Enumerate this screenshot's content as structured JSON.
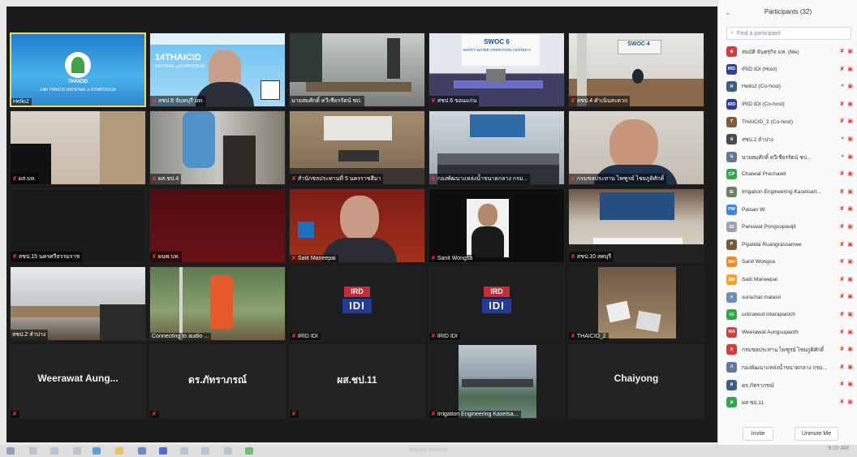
{
  "tiles": [
    {
      "name": "Hello2",
      "mic_off": false,
      "big_name": "",
      "scene": "logo",
      "active": true,
      "caption_line1": "THAICID",
      "caption_line2": "14th THAICID NATIONAL e-SYMPOSIUM"
    },
    {
      "name": "สชป.8 จันทบุรี มท.",
      "mic_off": true,
      "big_name": "",
      "scene": "speaker_banner",
      "active": false,
      "caption_line1": "14THAICID",
      "caption_line2": "NATIONAL e-SYMPOSIUM"
    },
    {
      "name": "นายสมศักดิ์ ควีเชียรรัตน์ ชป.",
      "mic_off": false,
      "big_name": "",
      "scene": "meeting_room",
      "active": false
    },
    {
      "name": "สชป.6 ขอนแก่น",
      "mic_off": true,
      "big_name": "",
      "scene": "swoc6",
      "active": false,
      "caption_line1": "SWOC 6",
      "caption_line2": "SMART WATER OPERATION CENTER 6"
    },
    {
      "name": "สชป.4 ดำเนินสะดวก",
      "mic_off": true,
      "big_name": "",
      "scene": "swoc4",
      "active": false,
      "caption_line1": "SWOC 4"
    },
    {
      "name": "ผส.บท.",
      "mic_off": true,
      "big_name": "",
      "scene": "office_chair",
      "active": false
    },
    {
      "name": "ผส.ชป.4",
      "mic_off": true,
      "big_name": "",
      "scene": "person_blue",
      "active": false
    },
    {
      "name": "สำนักชลประทานที่ 5 นครราชสีมา",
      "mic_off": true,
      "big_name": "",
      "scene": "meeting_board",
      "active": false
    },
    {
      "name": "กองพัฒนาแหล่งน้ำขนาดกลาง กรม...",
      "mic_off": true,
      "big_name": "",
      "scene": "conference_room",
      "active": false
    },
    {
      "name": "กรมชลประทาน ไพฑูรย์ ไชยภูติศักดิ์",
      "mic_off": true,
      "big_name": "",
      "scene": "older_man",
      "active": false
    },
    {
      "name": "สชป.15 นครศรีธรรมราช",
      "mic_off": true,
      "big_name": "",
      "scene": "black",
      "active": false
    },
    {
      "name": "ผนพ.บท.",
      "mic_off": true,
      "big_name": "",
      "scene": "dark_red",
      "active": false
    },
    {
      "name": "Satit Maneepai",
      "mic_off": true,
      "big_name": "",
      "scene": "man_red_bg",
      "active": false
    },
    {
      "name": "Sanit Wongsa",
      "mic_off": true,
      "big_name": "",
      "scene": "photo_man",
      "active": false
    },
    {
      "name": "สชป.10 ลพบุรี",
      "mic_off": true,
      "big_name": "",
      "scene": "meeting_room2",
      "active": false
    },
    {
      "name": "สชป.2 ลำปาง",
      "mic_off": false,
      "big_name": "",
      "scene": "hall",
      "active": false
    },
    {
      "name": "Connecting to audio ...",
      "mic_off": false,
      "big_name": "",
      "scene": "orange_device",
      "active": false
    },
    {
      "name": "IRID IDI",
      "mic_off": true,
      "big_name": "",
      "scene": "idi",
      "active": false
    },
    {
      "name": "IRID IDI",
      "mic_off": true,
      "big_name": "",
      "scene": "idi",
      "active": false
    },
    {
      "name": "THAICID_2",
      "mic_off": true,
      "big_name": "",
      "scene": "desk_papers",
      "active": false
    },
    {
      "name": "",
      "mic_off": true,
      "big_name": "Weerawat Aung...",
      "scene": "name_only",
      "active": false
    },
    {
      "name": "",
      "mic_off": true,
      "big_name": "ดร.ภัทราภรณ์",
      "scene": "name_only",
      "active": false
    },
    {
      "name": "",
      "mic_off": true,
      "big_name": "ผส.ชป.11",
      "scene": "name_only",
      "active": false
    },
    {
      "name": "Irrigation Engineering Kasetsa...",
      "mic_off": true,
      "big_name": "",
      "scene": "dam",
      "active": false
    },
    {
      "name": "",
      "mic_off": false,
      "big_name": "Chaiyong",
      "scene": "name_only",
      "active": false
    }
  ],
  "panel": {
    "title": "Participants (32)",
    "search_placeholder": "Find a participant",
    "invite_label": "Invite",
    "unmute_label": "Unmute Me",
    "participants": [
      {
        "name": "สมบัติ จันทรุกิจ มท. (Me)",
        "avatar": "ส",
        "color": "#d93a3a",
        "mic": "off"
      },
      {
        "name": "IRID IDI (Host)",
        "avatar": "IRD",
        "color": "#2b3f9a",
        "mic": "off"
      },
      {
        "name": "Hello2 (Co-host)",
        "avatar": "H",
        "color": "#3b5e89",
        "mic": "on"
      },
      {
        "name": "IRID IDI (Co-host)",
        "avatar": "IRD",
        "color": "#2b3f9a",
        "mic": "off"
      },
      {
        "name": "THAICID_2 (Co-host)",
        "avatar": "T",
        "color": "#7b5d43",
        "mic": "off"
      },
      {
        "name": "สชป.2 ลำปาง",
        "avatar": "ส",
        "color": "#4a4a4a",
        "mic": "on"
      },
      {
        "name": "นายสมศักดิ์ ควีเชียรรัตน์ ชป...",
        "avatar": "น",
        "color": "#5f7a96",
        "mic": "on"
      },
      {
        "name": "Chaiwat Prechawit",
        "avatar": "CP",
        "color": "#2eaa4a",
        "mic": "off"
      },
      {
        "name": "Irrigation Engineering Kasetsart...",
        "avatar": "IE",
        "color": "#6d7f5e",
        "mic": "off"
      },
      {
        "name": "Paisan W.",
        "avatar": "PW",
        "color": "#3a86d9",
        "mic": "off"
      },
      {
        "name": "Panuwat Pongsopavijit",
        "avatar": "53",
        "color": "#9aa4b0",
        "mic": "off"
      },
      {
        "name": "Piyatida Ruangrassamee",
        "avatar": "P",
        "color": "#7a5a35",
        "mic": "off"
      },
      {
        "name": "Sanit Wongsa",
        "avatar": "SW",
        "color": "#f08a24",
        "mic": "off"
      },
      {
        "name": "Satit Maneepai",
        "avatar": "SM",
        "color": "#f0a22a",
        "mic": "off"
      },
      {
        "name": "surachat malasri",
        "avatar": "s",
        "color": "#6b8fb8",
        "mic": "off"
      },
      {
        "name": "uckrawud intarapanich",
        "avatar": "UI",
        "color": "#2eaa4a",
        "mic": "off"
      },
      {
        "name": "Weerawat Aungsupanth",
        "avatar": "WA",
        "color": "#d93a3a",
        "mic": "off"
      },
      {
        "name": "กรมชลประทาน ไพฑูรย์ ไชยภูติศักดิ์",
        "avatar": "ก",
        "color": "#d93a3a",
        "mic": "off"
      },
      {
        "name": "กองพัฒนาแหล่งน้ำขนาดกลาง กรมชล...",
        "avatar": "ก",
        "color": "#5f7a96",
        "mic": "off"
      },
      {
        "name": "ดร.ภัทราภรณ์",
        "avatar": "ด",
        "color": "#3b5e89",
        "mic": "off"
      },
      {
        "name": "ผส.ชป.11",
        "avatar": "ผ",
        "color": "#2eaa4a",
        "mic": "off"
      }
    ]
  },
  "taskbar": {
    "clock": "9:10 AM",
    "watermark": "Activate Windows"
  }
}
